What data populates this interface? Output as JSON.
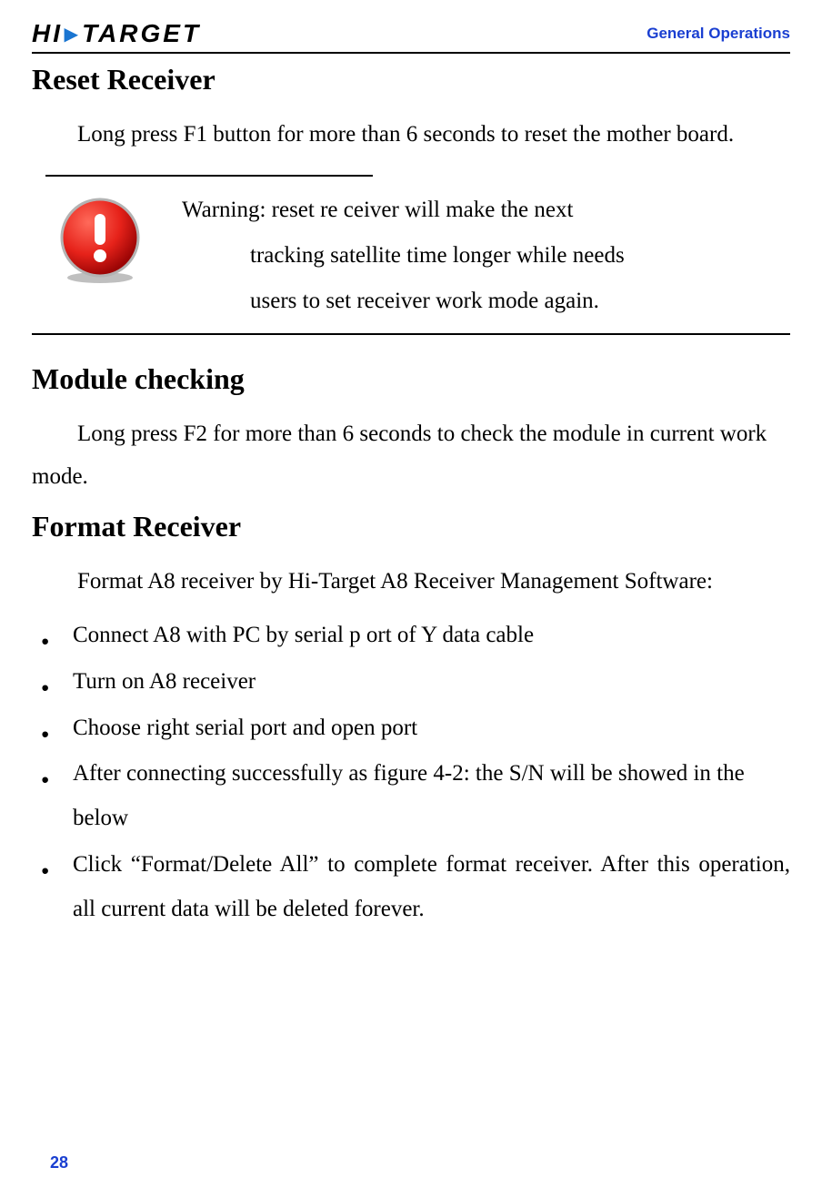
{
  "header": {
    "logo_left": "HI",
    "logo_right": "TARGET",
    "section_label": "General Operations"
  },
  "sections": {
    "reset": {
      "title": "Reset Receiver",
      "body": "Long press F1 button for more than 6 seconds to reset the mother board."
    },
    "warning": {
      "line1": "Warning: reset re ceiver will make the next",
      "line2": "tracking satellite time longer while needs",
      "line3": "users to set receiver work mode again."
    },
    "module": {
      "title": "Module checking",
      "body": "Long press F2 for more than 6 seconds to check the module in current work mode."
    },
    "format": {
      "title": "Format Receiver",
      "intro": "Format A8 receiver by Hi-Target A8 Receiver Management Software:",
      "steps": [
        "Connect A8 with PC by serial p ort of Y data cable",
        "Turn on A8 receiver",
        "Choose right serial port and open port",
        "After connecting successfully as figure 4-2: the S/N will be showed in the below",
        "Click “Format/Delete All” to complete format receiver. After this operation, all current data will be deleted forever."
      ]
    }
  },
  "page_number": "28"
}
